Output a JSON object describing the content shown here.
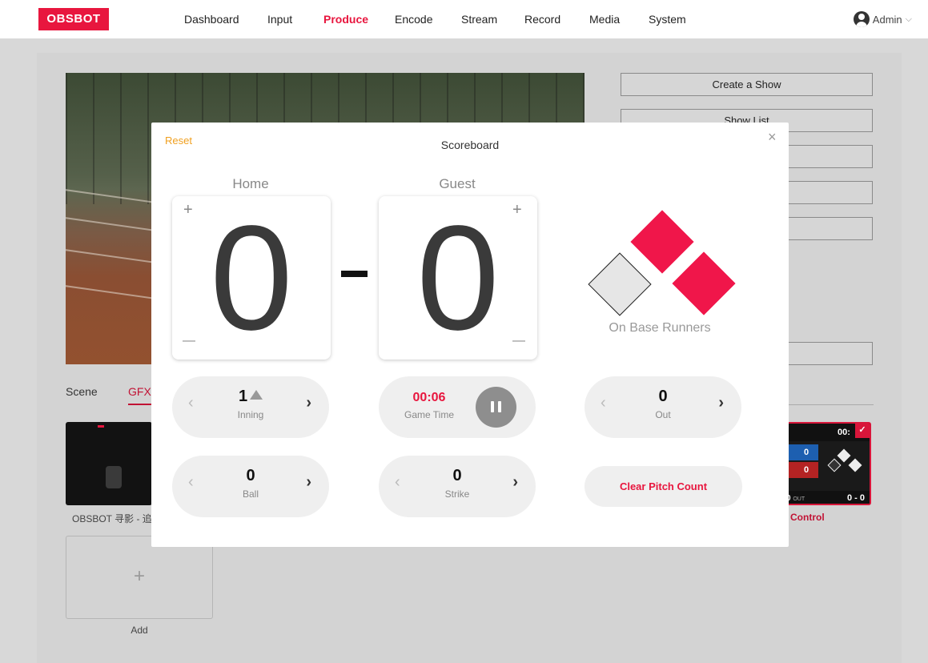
{
  "nav": {
    "logo": "OBSBOT",
    "items": [
      "Dashboard",
      "Input",
      "Produce",
      "Encode",
      "Stream",
      "Record",
      "Media",
      "System"
    ],
    "active": "Produce",
    "user": "Admin",
    "user_chevron": "⌵"
  },
  "side_buttons": [
    "Create a Show",
    "Show List"
  ],
  "tabs": {
    "scene": "Scene",
    "gfx": "GFX"
  },
  "thumbnails": {
    "first_label": "OBSBOT 寻影 - 追",
    "second_label": "Control",
    "second_preview": {
      "time": "00:",
      "home": "0",
      "guest": "0",
      "out": "0",
      "out_label": "OUT",
      "score": "0 - 0",
      "check": "✓"
    }
  },
  "add": {
    "plus": "+",
    "label": "Add"
  },
  "modal": {
    "reset": "Reset",
    "title": "Scoreboard",
    "close": "×",
    "home": {
      "label": "Home",
      "score": "0",
      "plus": "+",
      "minus": "—"
    },
    "guest": {
      "label": "Guest",
      "score": "0",
      "plus": "+",
      "minus": "—"
    },
    "runners_label": "On Base Runners",
    "bases": {
      "first": true,
      "second": true,
      "third": false
    },
    "inning": {
      "value": "1",
      "label": "Inning",
      "half": "top"
    },
    "game_time": {
      "value": "00:06",
      "label": "Game Time",
      "running": true
    },
    "out": {
      "value": "0",
      "label": "Out"
    },
    "ball": {
      "value": "0",
      "label": "Ball"
    },
    "strike": {
      "value": "0",
      "label": "Strike"
    },
    "clear_pitch": "Clear Pitch Count",
    "prev_icon": "‹",
    "next_icon": "›"
  },
  "colors": {
    "accent": "#e8163e",
    "reset": "#f0a020",
    "base_on": "#f0164a",
    "base_off": "#e6e6e6"
  }
}
